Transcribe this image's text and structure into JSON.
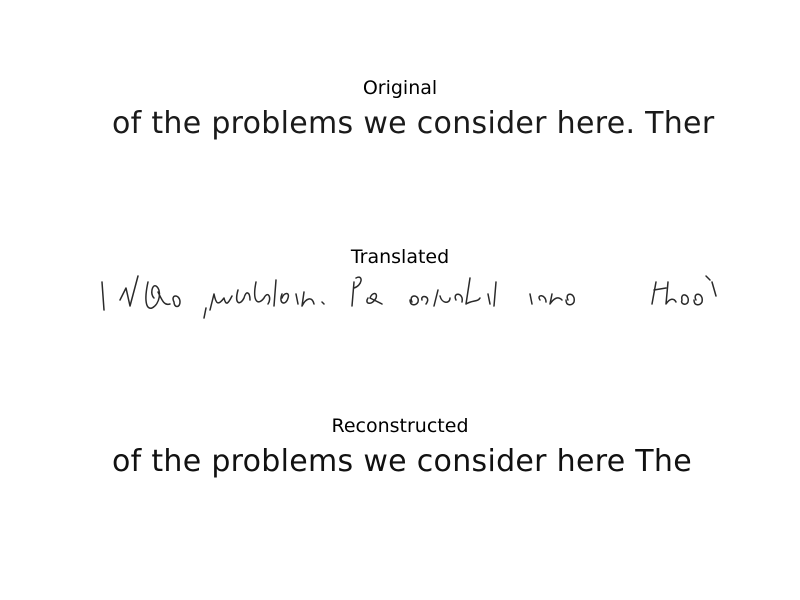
{
  "panels": [
    {
      "title": "Original",
      "text": "of the problems we consider here. Ther"
    },
    {
      "title": "Translated",
      "text": ""
    },
    {
      "title": "Reconstructed",
      "text": "of the problems we consider here The"
    }
  ]
}
